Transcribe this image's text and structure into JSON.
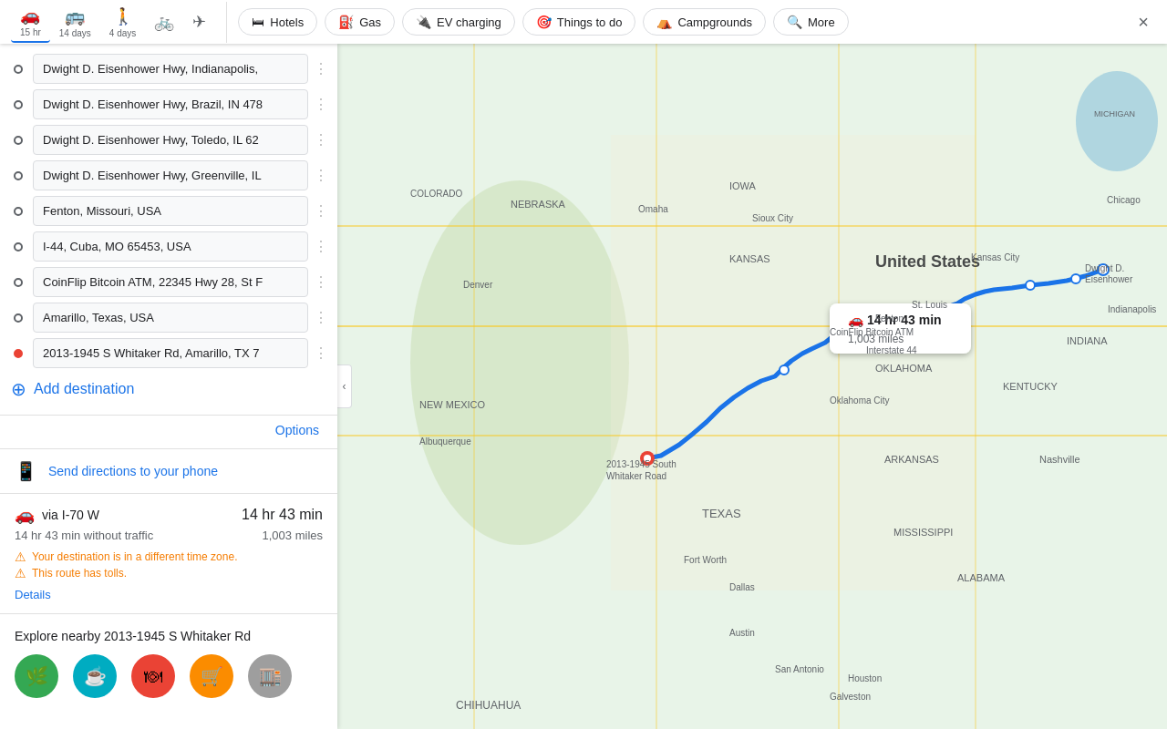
{
  "nav": {
    "transport_tabs": [
      {
        "id": "drive",
        "icon": "🚗",
        "time": "15 hr",
        "active": true
      },
      {
        "id": "transit",
        "icon": "🚌",
        "time": "14 days",
        "active": false
      },
      {
        "id": "walk",
        "icon": "🚶",
        "time": "4 days",
        "active": false
      },
      {
        "id": "bike",
        "icon": "🚲",
        "time": "",
        "active": false
      },
      {
        "id": "flight",
        "icon": "✈",
        "time": "",
        "active": false
      }
    ],
    "close_label": "×"
  },
  "poi_filters": [
    {
      "id": "hotels",
      "icon": "🛏",
      "label": "Hotels"
    },
    {
      "id": "gas",
      "icon": "⛽",
      "label": "Gas"
    },
    {
      "id": "ev",
      "icon": "🔌",
      "label": "EV charging"
    },
    {
      "id": "things",
      "icon": "🎯",
      "label": "Things to do"
    },
    {
      "id": "campgrounds",
      "icon": "⛺",
      "label": "Campgrounds"
    },
    {
      "id": "more",
      "icon": "🔍",
      "label": "More"
    }
  ],
  "waypoints": [
    {
      "id": "wp1",
      "value": "Dwight D. Eisenhower Hwy, Indianapolis,",
      "type": "start"
    },
    {
      "id": "wp2",
      "value": "Dwight D. Eisenhower Hwy, Brazil, IN 478",
      "type": "middle"
    },
    {
      "id": "wp3",
      "value": "Dwight D. Eisenhower Hwy, Toledo, IL 62",
      "type": "middle"
    },
    {
      "id": "wp4",
      "value": "Dwight D. Eisenhower Hwy, Greenville, IL",
      "type": "middle"
    },
    {
      "id": "wp5",
      "value": "Fenton, Missouri, USA",
      "type": "middle"
    },
    {
      "id": "wp6",
      "value": "I-44, Cuba, MO 65453, USA",
      "type": "middle"
    },
    {
      "id": "wp7",
      "value": "CoinFlip Bitcoin ATM, 22345 Hwy 28, St F",
      "type": "middle"
    },
    {
      "id": "wp8",
      "value": "Amarillo, Texas, USA",
      "type": "middle"
    },
    {
      "id": "wp9",
      "value": "2013-1945 S Whitaker Rd, Amarillo, TX 7",
      "type": "destination"
    }
  ],
  "add_destination": "Add destination",
  "options_label": "Options",
  "send_directions": {
    "label": "Send directions to your phone",
    "icon": "📱"
  },
  "route": {
    "via": "via I-70 W",
    "time": "14 hr 43 min",
    "without_traffic": "14 hr 43 min without traffic",
    "miles": "1,003 miles",
    "warnings": [
      "Your destination is in a different time zone.",
      "This route has tolls."
    ],
    "details_label": "Details"
  },
  "explore": {
    "title": "Explore nearby 2013-1945 S Whitaker Rd",
    "icons": [
      {
        "color": "#34a853",
        "icon": "🌿",
        "label": "Parks"
      },
      {
        "color": "#00acc1",
        "icon": "☕",
        "label": "Coffee"
      },
      {
        "color": "#ea4335",
        "icon": "🍽",
        "label": "Food"
      },
      {
        "color": "#fb8c00",
        "icon": "🛒",
        "label": "Shopping"
      },
      {
        "color": "#5f6368",
        "icon": "🏬",
        "label": "More"
      }
    ]
  },
  "tooltip": {
    "icon": "🚗",
    "time": "14 hr 43 min",
    "distance": "1,003 miles"
  }
}
